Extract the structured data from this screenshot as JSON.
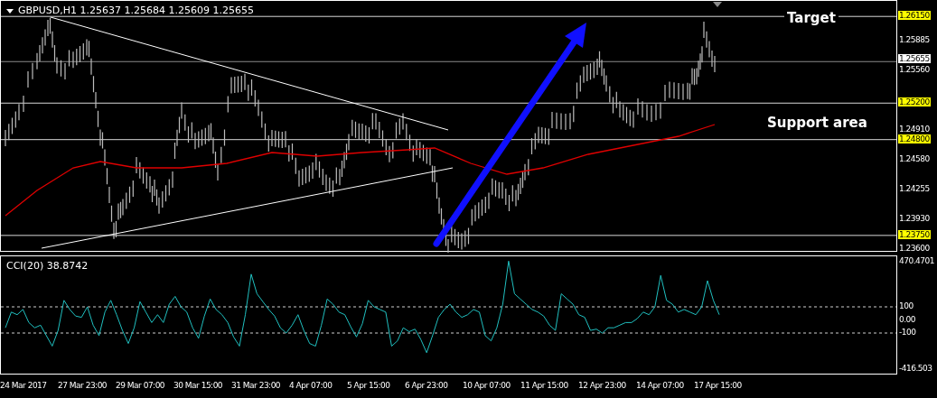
{
  "chart": {
    "title": "GBPUSD,H1 1.25637 1.25684 1.25609 1.25655",
    "annotations": [
      {
        "kind": "target",
        "text": "Target"
      },
      {
        "kind": "support",
        "text": "Support area"
      }
    ],
    "price_axis": [
      {
        "label": "1.26150",
        "kind": "level"
      },
      {
        "label": "1.25885",
        "kind": "tick"
      },
      {
        "label": "1.25655",
        "kind": "current"
      },
      {
        "label": "1.25560",
        "kind": "tick"
      },
      {
        "label": "1.25200",
        "kind": "level"
      },
      {
        "label": "1.24910",
        "kind": "tick"
      },
      {
        "label": "1.24800",
        "kind": "level"
      },
      {
        "label": "1.24580",
        "kind": "tick"
      },
      {
        "label": "1.24255",
        "kind": "tick"
      },
      {
        "label": "1.23930",
        "kind": "tick"
      },
      {
        "label": "1.23750",
        "kind": "level"
      },
      {
        "label": "1.23600",
        "kind": "tick"
      }
    ]
  },
  "indicator": {
    "title": "CCI(20) 38.8742",
    "axis": [
      {
        "label": "470.4701",
        "kind": "tick"
      },
      {
        "label": "100",
        "kind": "level"
      },
      {
        "label": "0.00",
        "kind": "tick"
      },
      {
        "label": "-100",
        "kind": "level"
      },
      {
        "label": "-416.503",
        "kind": "tick"
      }
    ]
  },
  "time_axis": [
    "24 Mar 2017",
    "27 Mar 23:00",
    "29 Mar 07:00",
    "30 Mar 15:00",
    "31 Mar 23:00",
    "4 Apr 07:00",
    "5 Apr 15:00",
    "6 Apr 23:00",
    "10 Apr 07:00",
    "11 Apr 15:00",
    "12 Apr 23:00",
    "14 Apr 07:00",
    "17 Apr 15:00"
  ]
}
